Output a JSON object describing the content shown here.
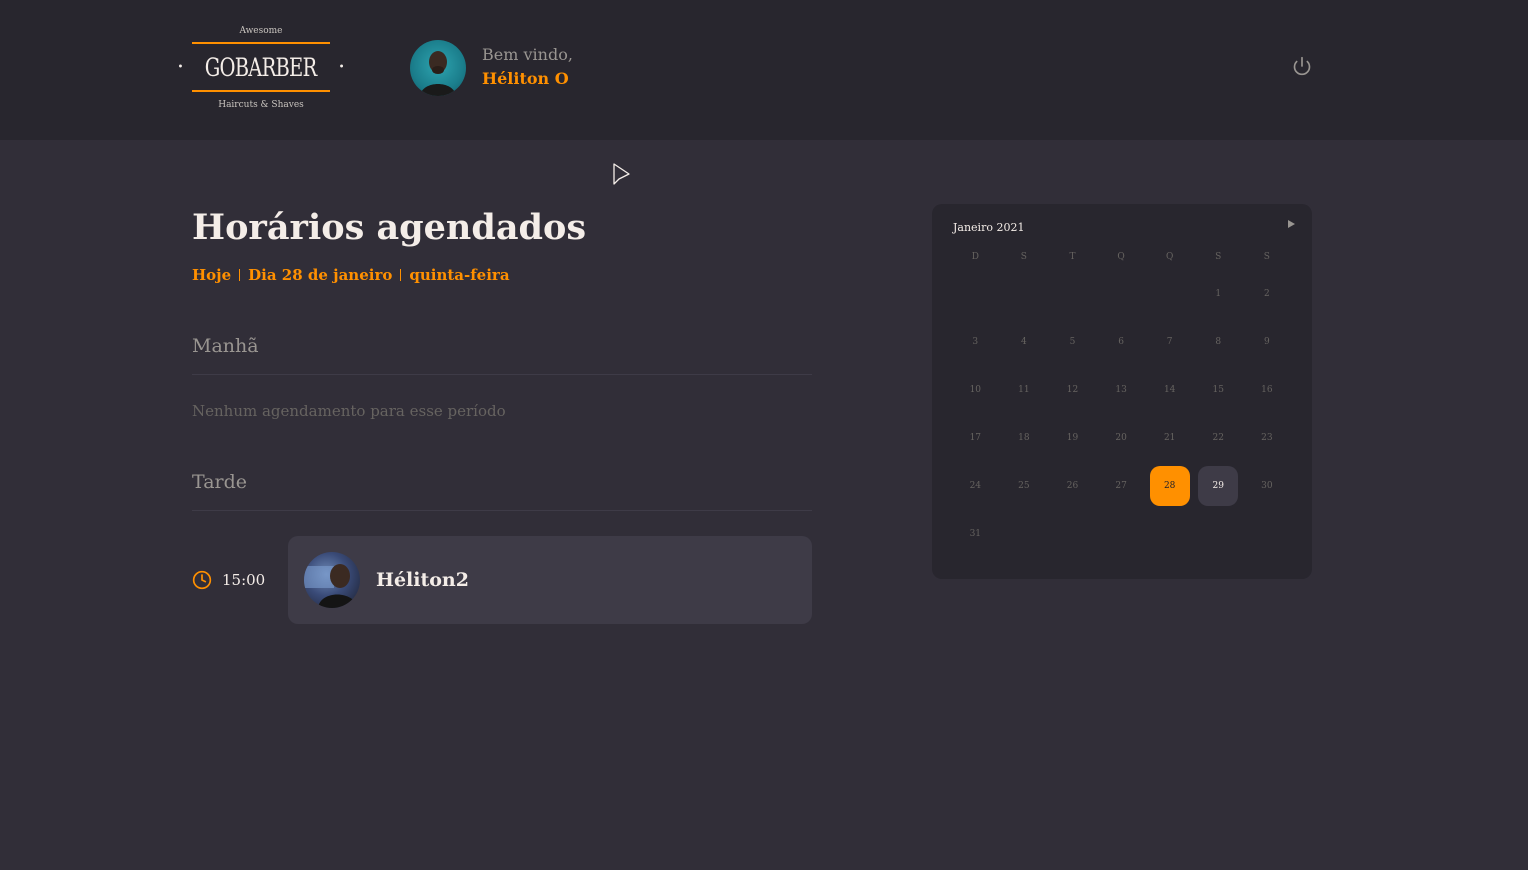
{
  "header": {
    "logo": {
      "top": "Awesome",
      "brand": "GOBARBER",
      "bottom": "Haircuts & Shaves"
    },
    "welcome": "Bem vindo,",
    "user_name": "Héliton O",
    "icons": {
      "logout": "power-icon",
      "avatar": "user-avatar"
    }
  },
  "schedule": {
    "title": "Horários agendados",
    "today": "Hoje",
    "day_label": "Dia 28 de janeiro",
    "weekday": "quinta-feira",
    "morning": {
      "title": "Manhã",
      "empty": "Nenhum agendamento para esse período"
    },
    "afternoon": {
      "title": "Tarde",
      "appointments": [
        {
          "time": "15:00",
          "name": "Héliton2",
          "icon": "clock-icon"
        }
      ]
    }
  },
  "calendar": {
    "caption": "Janeiro 2021",
    "weekdays": [
      "D",
      "S",
      "T",
      "Q",
      "Q",
      "S",
      "S"
    ],
    "leading_blank_days": 5,
    "days": [
      "1",
      "2",
      "3",
      "4",
      "5",
      "6",
      "7",
      "8",
      "9",
      "10",
      "11",
      "12",
      "13",
      "14",
      "15",
      "16",
      "17",
      "18",
      "19",
      "20",
      "21",
      "22",
      "23",
      "24",
      "25",
      "26",
      "27",
      "28",
      "29",
      "30",
      "31"
    ],
    "selected_day": "28",
    "available_days": [
      "29"
    ],
    "colors": {
      "accent": "#ff9000",
      "available": "#3e3b47"
    }
  }
}
